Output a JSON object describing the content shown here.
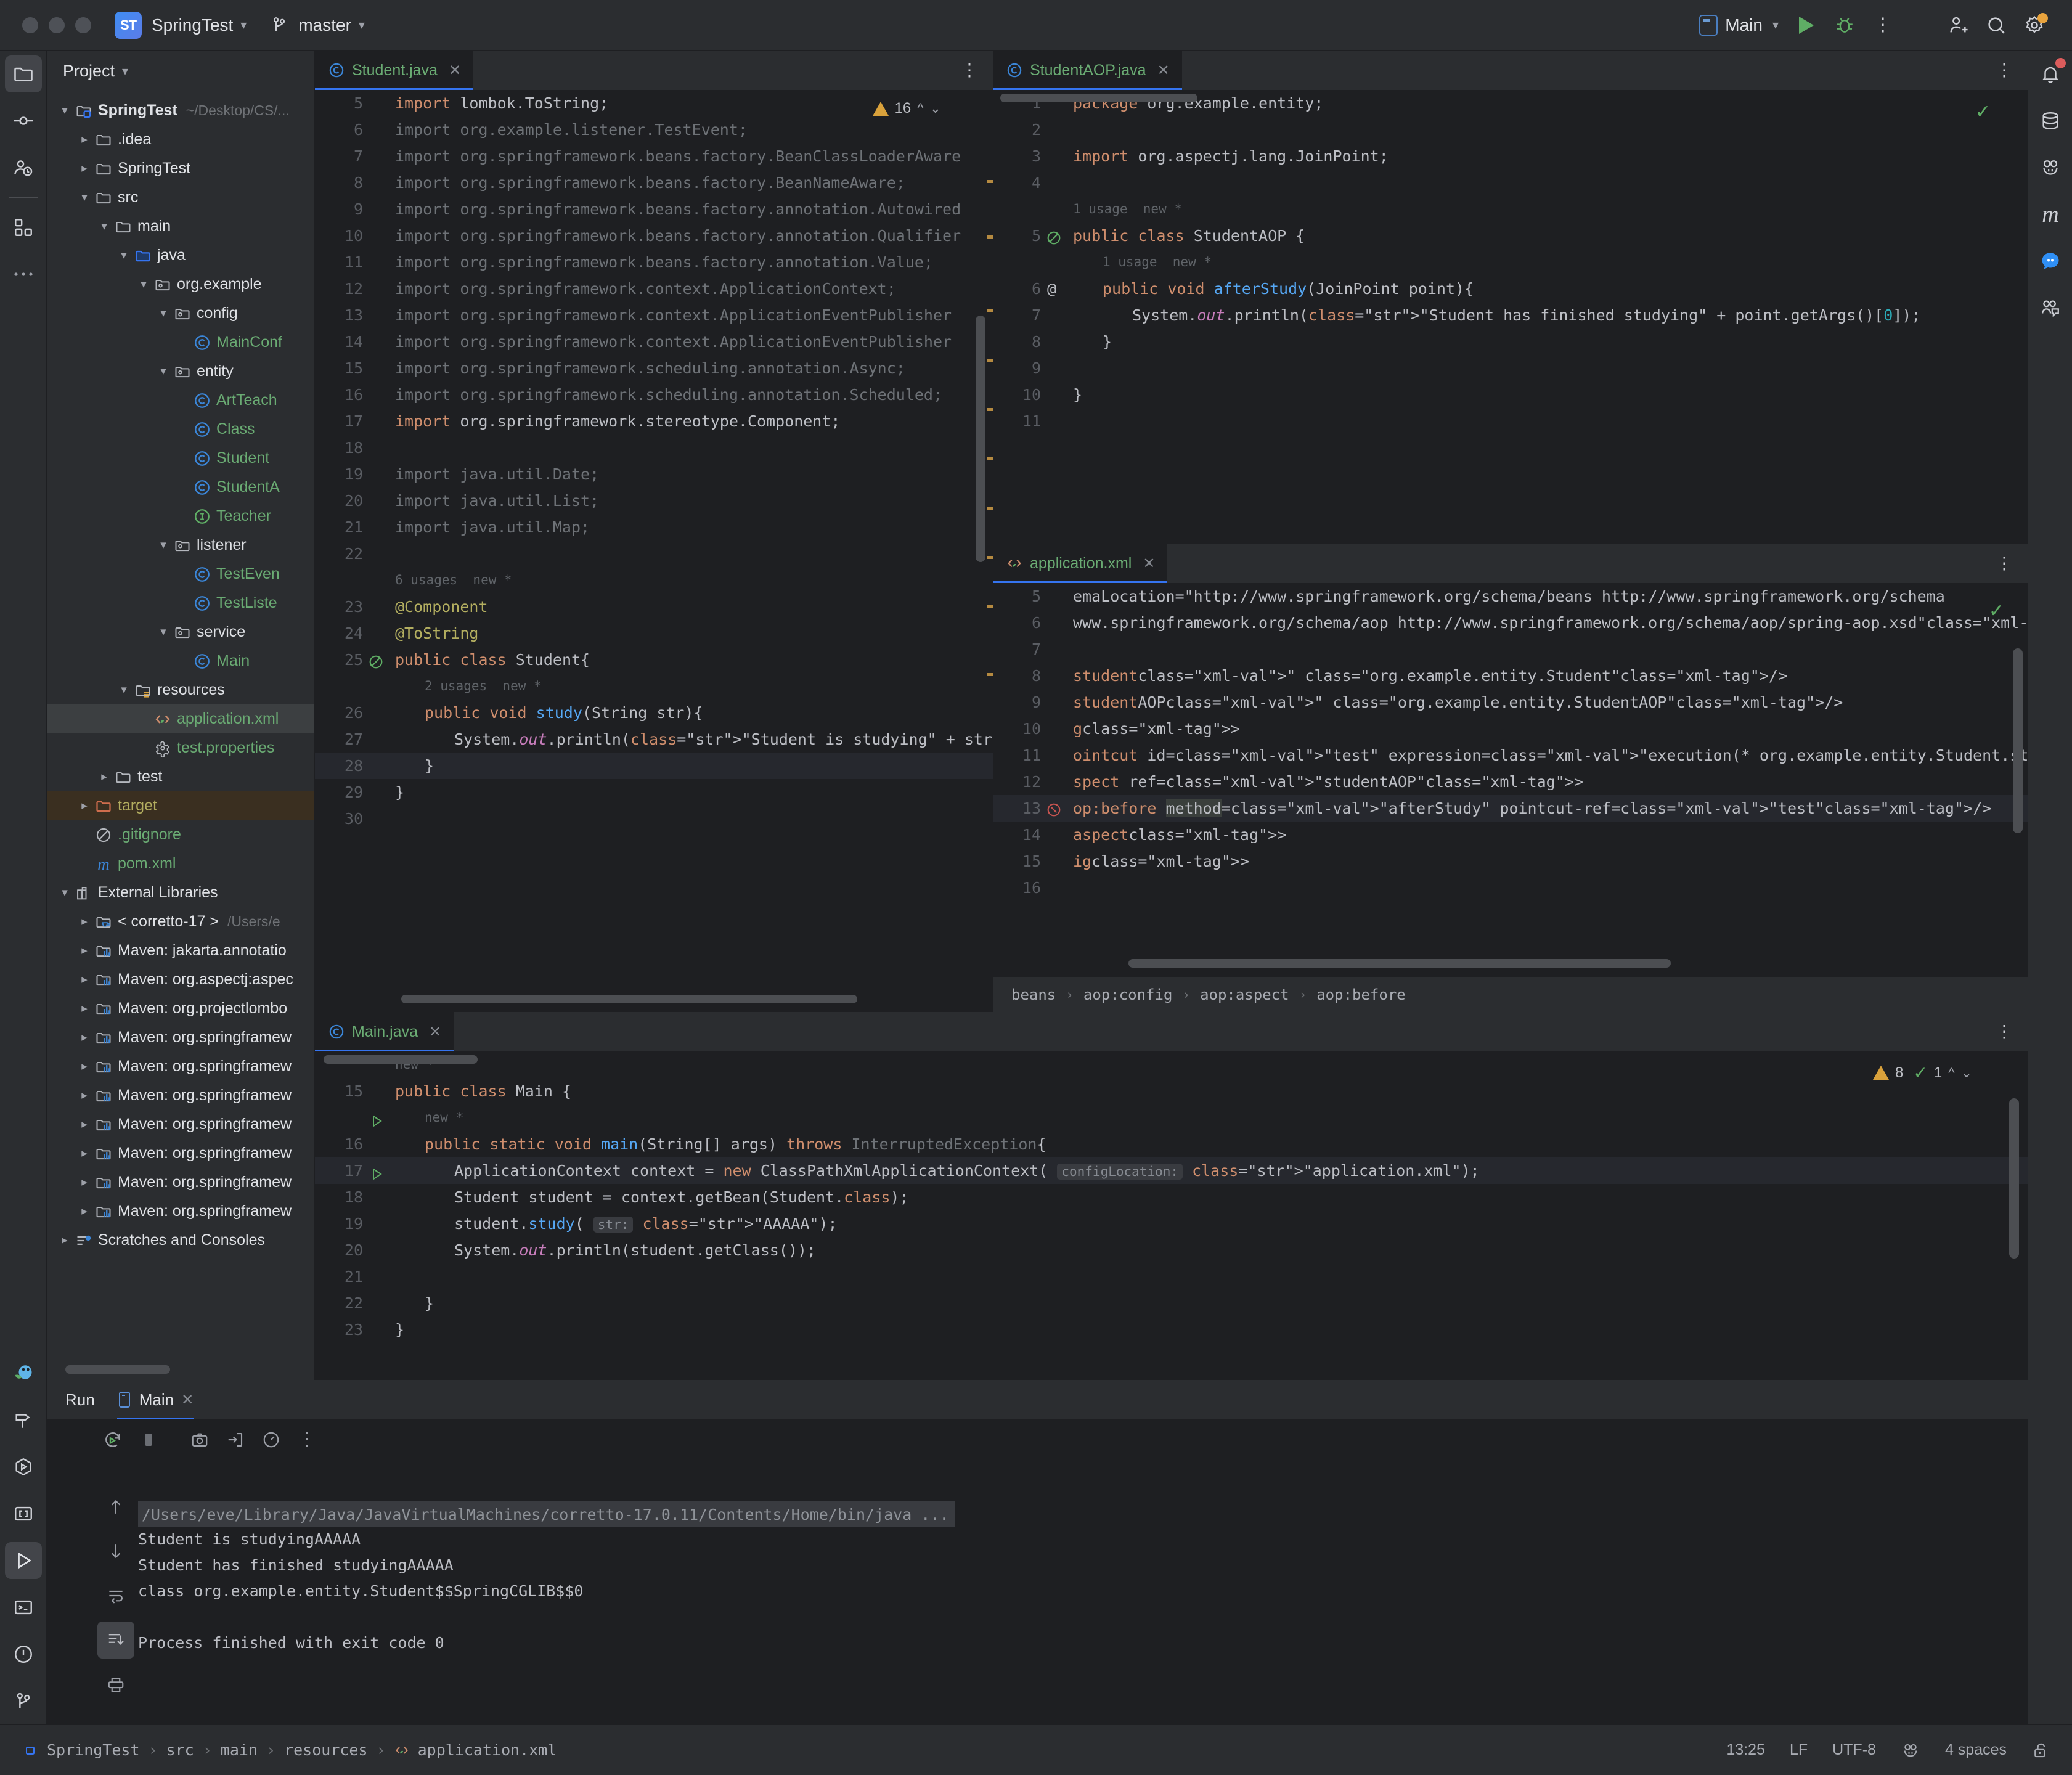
{
  "titlebar": {
    "project_badge": "ST",
    "project_name": "SpringTest",
    "branch": "master",
    "run_config": "Main",
    "icons": [
      "run-icon",
      "debug-icon",
      "more-actions-icon",
      "add-user-icon",
      "search-icon",
      "settings-icon"
    ]
  },
  "rail_left": [
    "project-icon",
    "commit-icon",
    "pull-requests-icon",
    "plugins-icon",
    "more-tool-windows-icon"
  ],
  "rail_left_bottom": [
    "spring-icon",
    "build-icon",
    "run-anything-icon",
    "terminal-brackets-icon",
    "run-icon",
    "terminal-icon",
    "problems-icon",
    "version-control-icon"
  ],
  "rail_right": [
    "notifications-icon",
    "database-icon",
    "ai-assistant-icon",
    "maven-icon",
    "chat-icon",
    "code-with-me-icon"
  ],
  "project_panel": {
    "title": "Project",
    "tree": [
      {
        "depth": 0,
        "arrow": "down",
        "icon": "module-folder",
        "label": "SpringTest",
        "path": "~/Desktop/CS/...",
        "style": "bold"
      },
      {
        "depth": 1,
        "arrow": "right",
        "icon": "folder",
        "label": ".idea",
        "style": "white"
      },
      {
        "depth": 1,
        "arrow": "right",
        "icon": "folder",
        "label": "SpringTest",
        "style": "white"
      },
      {
        "depth": 1,
        "arrow": "down",
        "icon": "folder",
        "label": "src",
        "style": "white"
      },
      {
        "depth": 2,
        "arrow": "down",
        "icon": "folder",
        "label": "main",
        "style": "white"
      },
      {
        "depth": 3,
        "arrow": "down",
        "icon": "source-folder",
        "label": "java",
        "style": "white"
      },
      {
        "depth": 4,
        "arrow": "down",
        "icon": "package",
        "label": "org.example",
        "style": "white"
      },
      {
        "depth": 5,
        "arrow": "down",
        "icon": "package",
        "label": "config",
        "style": "white"
      },
      {
        "depth": 6,
        "arrow": "none",
        "icon": "class",
        "label": "MainConf",
        "style": "green"
      },
      {
        "depth": 5,
        "arrow": "down",
        "icon": "package",
        "label": "entity",
        "style": "white"
      },
      {
        "depth": 6,
        "arrow": "none",
        "icon": "class",
        "label": "ArtTeach",
        "style": "green"
      },
      {
        "depth": 6,
        "arrow": "none",
        "icon": "class",
        "label": "Class",
        "style": "green"
      },
      {
        "depth": 6,
        "arrow": "none",
        "icon": "class",
        "label": "Student",
        "style": "green"
      },
      {
        "depth": 6,
        "arrow": "none",
        "icon": "class",
        "label": "StudentA",
        "style": "green"
      },
      {
        "depth": 6,
        "arrow": "none",
        "icon": "interface",
        "label": "Teacher",
        "style": "green"
      },
      {
        "depth": 5,
        "arrow": "down",
        "icon": "package",
        "label": "listener",
        "style": "white"
      },
      {
        "depth": 6,
        "arrow": "none",
        "icon": "class",
        "label": "TestEven",
        "style": "green"
      },
      {
        "depth": 6,
        "arrow": "none",
        "icon": "class",
        "label": "TestListe",
        "style": "green"
      },
      {
        "depth": 5,
        "arrow": "down",
        "icon": "package",
        "label": "service",
        "style": "white"
      },
      {
        "depth": 6,
        "arrow": "none",
        "icon": "class",
        "label": "Main",
        "style": "green"
      },
      {
        "depth": 3,
        "arrow": "down",
        "icon": "resource-folder",
        "label": "resources",
        "style": "white"
      },
      {
        "depth": 4,
        "arrow": "none",
        "icon": "spring-xml",
        "label": "application.xml",
        "style": "green",
        "selected": "grey"
      },
      {
        "depth": 4,
        "arrow": "none",
        "icon": "properties",
        "label": "test.properties",
        "style": "green"
      },
      {
        "depth": 2,
        "arrow": "right",
        "icon": "folder",
        "label": "test",
        "style": "white"
      },
      {
        "depth": 1,
        "arrow": "right",
        "icon": "excluded-folder",
        "label": "target",
        "style": "target",
        "selected": "orange"
      },
      {
        "depth": 1,
        "arrow": "none",
        "icon": "gitignore",
        "label": ".gitignore",
        "style": "green"
      },
      {
        "depth": 1,
        "arrow": "none",
        "icon": "maven-m",
        "label": "pom.xml",
        "style": "green"
      },
      {
        "depth": 0,
        "arrow": "down",
        "icon": "libraries",
        "label": "External Libraries",
        "style": "white"
      },
      {
        "depth": 1,
        "arrow": "right",
        "icon": "jdk",
        "label": "< corretto-17 >",
        "path": "/Users/e",
        "style": "white"
      },
      {
        "depth": 1,
        "arrow": "right",
        "icon": "lib",
        "label": "Maven: jakarta.annotatio",
        "style": "white"
      },
      {
        "depth": 1,
        "arrow": "right",
        "icon": "lib",
        "label": "Maven: org.aspectj:aspec",
        "style": "white"
      },
      {
        "depth": 1,
        "arrow": "right",
        "icon": "lib",
        "label": "Maven: org.projectlombo",
        "style": "white"
      },
      {
        "depth": 1,
        "arrow": "right",
        "icon": "lib",
        "label": "Maven: org.springframew",
        "style": "white"
      },
      {
        "depth": 1,
        "arrow": "right",
        "icon": "lib",
        "label": "Maven: org.springframew",
        "style": "white"
      },
      {
        "depth": 1,
        "arrow": "right",
        "icon": "lib",
        "label": "Maven: org.springframew",
        "style": "white"
      },
      {
        "depth": 1,
        "arrow": "right",
        "icon": "lib",
        "label": "Maven: org.springframew",
        "style": "white"
      },
      {
        "depth": 1,
        "arrow": "right",
        "icon": "lib",
        "label": "Maven: org.springframew",
        "style": "white"
      },
      {
        "depth": 1,
        "arrow": "right",
        "icon": "lib",
        "label": "Maven: org.springframew",
        "style": "white"
      },
      {
        "depth": 1,
        "arrow": "right",
        "icon": "lib",
        "label": "Maven: org.springframew",
        "style": "white"
      },
      {
        "depth": 0,
        "arrow": "right",
        "icon": "scratches",
        "label": "Scratches and Consoles",
        "style": "white"
      }
    ]
  },
  "editor_student": {
    "tab": "Student.java",
    "inspection": {
      "warnings": "16"
    },
    "lines": [
      {
        "n": "5",
        "t": "import lombok.ToString;"
      },
      {
        "n": "6",
        "t": "import org.example.listener.TestEvent;"
      },
      {
        "n": "7",
        "t": "import org.springframework.beans.factory.BeanClassLoaderAware"
      },
      {
        "n": "8",
        "t": "import org.springframework.beans.factory.BeanNameAware;"
      },
      {
        "n": "9",
        "t": "import org.springframework.beans.factory.annotation.Autowired"
      },
      {
        "n": "10",
        "t": "import org.springframework.beans.factory.annotation.Qualifier"
      },
      {
        "n": "11",
        "t": "import org.springframework.beans.factory.annotation.Value;"
      },
      {
        "n": "12",
        "t": "import org.springframework.context.ApplicationContext;"
      },
      {
        "n": "13",
        "t": "import org.springframework.context.ApplicationEventPublisher"
      },
      {
        "n": "14",
        "t": "import org.springframework.context.ApplicationEventPublisher"
      },
      {
        "n": "15",
        "t": "import org.springframework.scheduling.annotation.Async;"
      },
      {
        "n": "16",
        "t": "import org.springframework.scheduling.annotation.Scheduled;"
      },
      {
        "n": "17",
        "t": "import org.springframework.stereotype.Component;"
      },
      {
        "n": "18",
        "t": ""
      },
      {
        "n": "19",
        "t": "import java.util.Date;"
      },
      {
        "n": "20",
        "t": "import java.util.List;"
      },
      {
        "n": "21",
        "t": "import java.util.Map;"
      },
      {
        "n": "22",
        "t": ""
      },
      {
        "n": "",
        "t": "6 usages  new *",
        "hint": true
      },
      {
        "n": "23",
        "t": "@Component"
      },
      {
        "n": "24",
        "t": "@ToString"
      },
      {
        "n": "25",
        "t": "public class Student{"
      },
      {
        "n": "",
        "t": "2 usages  new *",
        "hint": true
      },
      {
        "n": "26",
        "t": "public void study(String str){"
      },
      {
        "n": "27",
        "t": "System.out.println(\"Student is studying\" + str);"
      },
      {
        "n": "28",
        "t": "}"
      },
      {
        "n": "29",
        "t": "}"
      },
      {
        "n": "30",
        "t": ""
      }
    ]
  },
  "editor_studentaop": {
    "tab": "StudentAOP.java",
    "lines": [
      {
        "n": "1",
        "t": "package org.example.entity;"
      },
      {
        "n": "2",
        "t": ""
      },
      {
        "n": "3",
        "t": "import org.aspectj.lang.JoinPoint;"
      },
      {
        "n": "4",
        "t": ""
      },
      {
        "n": "",
        "t": "1 usage  new *",
        "hint": true
      },
      {
        "n": "5",
        "t": "public class StudentAOP {"
      },
      {
        "n": "",
        "t": "1 usage  new *",
        "hint": true
      },
      {
        "n": "6",
        "t": "public void afterStudy(JoinPoint point){"
      },
      {
        "n": "7",
        "t": "System.out.println(\"Student has finished studying\" + point.getArgs()[0]);"
      },
      {
        "n": "8",
        "t": "}"
      },
      {
        "n": "9",
        "t": ""
      },
      {
        "n": "10",
        "t": "}"
      },
      {
        "n": "11",
        "t": ""
      }
    ]
  },
  "editor_appxml": {
    "tab": "application.xml",
    "breadcrumb": [
      "beans",
      "aop:config",
      "aop:aspect",
      "aop:before"
    ],
    "lines": [
      {
        "n": "5",
        "t": "emaLocation=\"http://www.springframework.org/schema/beans http://www.springframework.org/schema"
      },
      {
        "n": "6",
        "t": "www.springframework.org/schema/aop http://www.springframework.org/schema/aop/spring-aop.xsd\">"
      },
      {
        "n": "7",
        "t": ""
      },
      {
        "n": "8",
        "t": "student\" class=\"org.example.entity.Student\"/>"
      },
      {
        "n": "9",
        "t": "studentAOP\" class=\"org.example.entity.StudentAOP\"/>"
      },
      {
        "n": "10",
        "t": "g>"
      },
      {
        "n": "11",
        "t": "ointcut id=\"test\" expression=\"execution(* org.example.entity.Student.study(String))\"/>"
      },
      {
        "n": "12",
        "t": "spect ref=\"studentAOP\">"
      },
      {
        "n": "13",
        "t": "op:before method=\"afterStudy\" pointcut-ref=\"test\"/>"
      },
      {
        "n": "14",
        "t": "aspect>"
      },
      {
        "n": "15",
        "t": "ig>"
      },
      {
        "n": "16",
        "t": ""
      }
    ]
  },
  "editor_main": {
    "tab": "Main.java",
    "inspection": {
      "warnings": "8",
      "weak": "1"
    },
    "lines": [
      {
        "n": "",
        "t": "new *",
        "hint": true
      },
      {
        "n": "15",
        "t": "public class Main {"
      },
      {
        "n": "",
        "t": "new *",
        "hint": true
      },
      {
        "n": "16",
        "t": "public static void main(String[] args) throws InterruptedException{"
      },
      {
        "n": "17",
        "t": "ApplicationContext context = new ClassPathXmlApplicationContext( configLocation: \"application.xml\");"
      },
      {
        "n": "18",
        "t": "Student student = context.getBean(Student.class);"
      },
      {
        "n": "19",
        "t": "student.study( str: \"AAAAA\");"
      },
      {
        "n": "20",
        "t": "System.out.println(student.getClass());"
      },
      {
        "n": "21",
        "t": ""
      },
      {
        "n": "22",
        "t": "}"
      },
      {
        "n": "23",
        "t": "}"
      }
    ]
  },
  "run_panel": {
    "title": "Run",
    "tab": "Main",
    "toolbar_icons": [
      "rerun-icon",
      "stop-icon",
      "screenshot-icon",
      "export-icon",
      "profile-icon",
      "more-icon"
    ],
    "side_icons": [
      "up-icon",
      "down-icon",
      "soft-wrap-icon",
      "scroll-end-icon",
      "print-icon"
    ],
    "console": [
      {
        "text": "/Users/eve/Library/Java/JavaVirtualMachines/corretto-17.0.11/Contents/Home/bin/java ...",
        "kind": "cmd"
      },
      {
        "text": "Student is studyingAAAAA",
        "kind": "out"
      },
      {
        "text": "Student has finished studyingAAAAA",
        "kind": "out"
      },
      {
        "text": "class org.example.entity.Student$$SpringCGLIB$$0",
        "kind": "out"
      },
      {
        "text": "",
        "kind": "out"
      },
      {
        "text": "Process finished with exit code 0",
        "kind": "out"
      }
    ]
  },
  "statusbar": {
    "breadcrumb": [
      "SpringTest",
      "src",
      "main",
      "resources",
      "application.xml"
    ],
    "time": "13:25",
    "line_sep": "LF",
    "encoding": "UTF-8",
    "indent": "4 spaces",
    "icons": [
      "ai-assistant-icon",
      "lock-icon"
    ]
  },
  "colors": {
    "accent": "#3574f0",
    "keyword": "#cf8e6d",
    "string": "#6aab73",
    "annotation": "#b3ae60",
    "method": "#56a8f5",
    "field": "#c77dbb",
    "warning": "#d9a13b",
    "ok": "#5fad65",
    "bg_editor": "#1e1f22",
    "bg_panel": "#2b2d30"
  }
}
